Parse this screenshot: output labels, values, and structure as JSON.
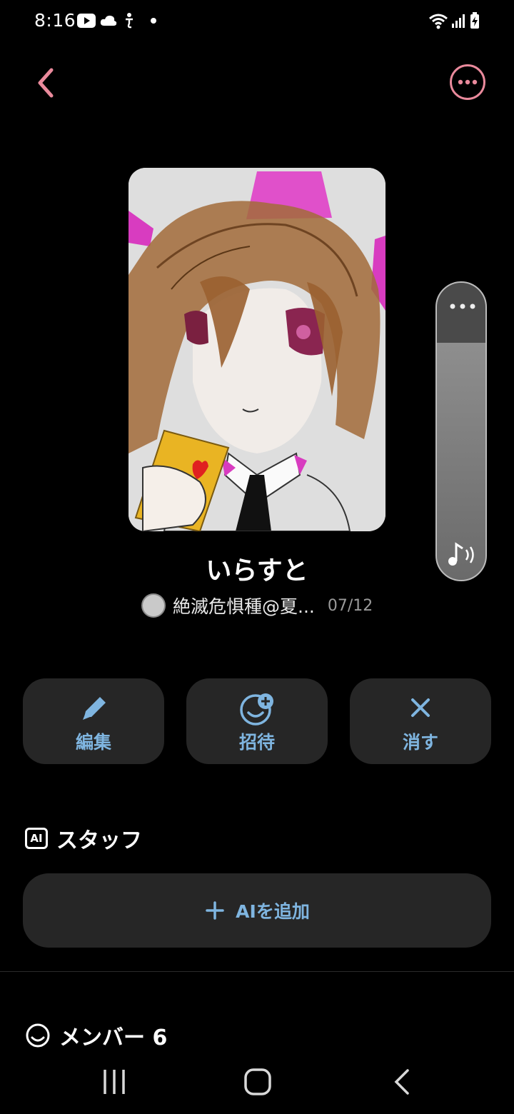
{
  "status_bar": {
    "time": "8:16"
  },
  "header": {
    "back_icon": "chevron-left-icon",
    "more_icon": "more-horizontal-icon",
    "accent_color": "#ea8a9c"
  },
  "room": {
    "title": "いらすと",
    "owner_name": "絶滅危惧種@夏...",
    "date": "07/12"
  },
  "actions": [
    {
      "label": "編集",
      "icon": "pencil-icon"
    },
    {
      "label": "招待",
      "icon": "add-smiley-icon"
    },
    {
      "label": "消す",
      "icon": "close-icon"
    }
  ],
  "ai_staff": {
    "badge": "AI",
    "title": "スタッフ",
    "add_label": "AIを追加",
    "add_icon": "plus-icon"
  },
  "members": {
    "title": "メンバー 6",
    "icon": "smiley-icon"
  },
  "slider": {
    "menu_icon": "more-horizontal-icon",
    "sound_icon": "music-sound-icon"
  },
  "colors": {
    "action_text": "#7fb5e0",
    "button_bg": "#262626"
  }
}
